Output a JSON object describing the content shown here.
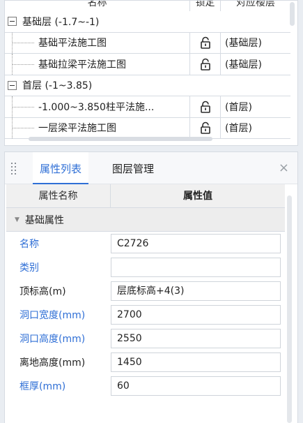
{
  "tree": {
    "headers": {
      "name": "名称",
      "lock": "锁定",
      "floor": "对应楼层"
    },
    "rows": [
      {
        "type": "group",
        "label": "基础层 (-1.7~-1)"
      },
      {
        "type": "child",
        "label": "基础平法施工图",
        "floor": "(基础层)"
      },
      {
        "type": "child",
        "label": "基础拉梁平法施工图",
        "floor": "(基础层)"
      },
      {
        "type": "group",
        "label": "首层 (-1~3.85)"
      },
      {
        "type": "child",
        "label": "-1.000~3.850柱平法施...",
        "floor": "(首层)"
      },
      {
        "type": "child",
        "label": "一层梁平法施工图",
        "floor": "(首层)"
      }
    ]
  },
  "props": {
    "tabs": {
      "attributes": "属性列表",
      "layers": "图层管理"
    },
    "close_glyph": "×",
    "table_headers": {
      "name": "属性名称",
      "value": "属性值"
    },
    "group_title": "基础属性",
    "rows": [
      {
        "name": "名称",
        "value": "C2726",
        "highlight": true
      },
      {
        "name": "类别",
        "value": "",
        "highlight": true
      },
      {
        "name": "顶标高(m)",
        "value": "层底标高+4(3)",
        "highlight": false
      },
      {
        "name": "洞口宽度(mm)",
        "value": "2700",
        "highlight": true
      },
      {
        "name": "洞口高度(mm)",
        "value": "2550",
        "highlight": true
      },
      {
        "name": "离地高度(mm)",
        "value": "1450",
        "highlight": false
      },
      {
        "name": "框厚(mm)",
        "value": "60",
        "highlight": true
      }
    ]
  },
  "colors": {
    "accent": "#2f6fd6",
    "group_bg": "#ededed",
    "border": "#d6dbe2"
  },
  "icons": {
    "lock": "unlock-icon",
    "expander": "collapse-minus-icon",
    "grip": "drag-grip-icon"
  }
}
